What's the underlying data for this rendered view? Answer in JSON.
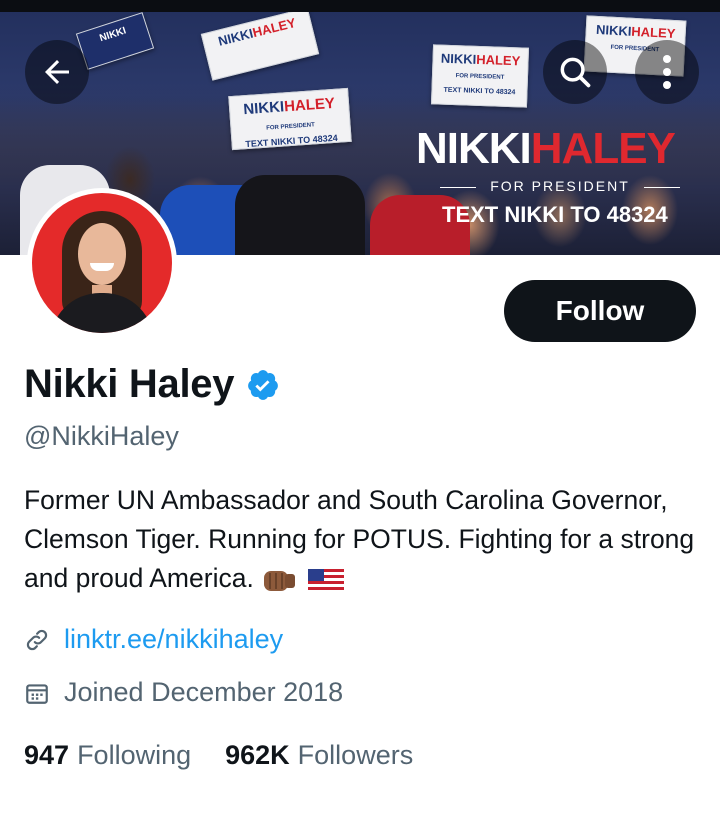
{
  "banner": {
    "title_part1": "NIKKI",
    "title_part2": "HALEY",
    "subtitle": "FOR PRESIDENT",
    "text_line": "TEXT NIKKI TO 48324",
    "sign_name_1": "NIKKI",
    "sign_name_2": "HALEY",
    "sign_sub": "FOR PRESIDENT",
    "sign_text": "TEXT NIKKI TO 48324"
  },
  "profile": {
    "name": "Nikki Haley",
    "handle": "@NikkiHaley",
    "bio_text": "Former UN Ambassador and South Carolina Governor, Clemson Tiger. Running for POTUS. Fighting for a strong and proud America.",
    "link": "linktr.ee/nikkihaley",
    "joined": "Joined December 2018",
    "following_count": "947",
    "following_label": "Following",
    "followers_count": "962K",
    "followers_label": "Followers",
    "verified_color": "#1d9bf0"
  },
  "actions": {
    "follow_label": "Follow"
  },
  "icons": {
    "back": "arrow-left-icon",
    "search": "search-icon",
    "more": "more-vertical-icon",
    "link": "link-icon",
    "calendar": "calendar-icon",
    "verified": "verified-badge-icon"
  },
  "colors": {
    "accent": "#1d9bf0",
    "text_primary": "#0f1419",
    "text_secondary": "#536471",
    "brand_red": "#e0282f"
  }
}
